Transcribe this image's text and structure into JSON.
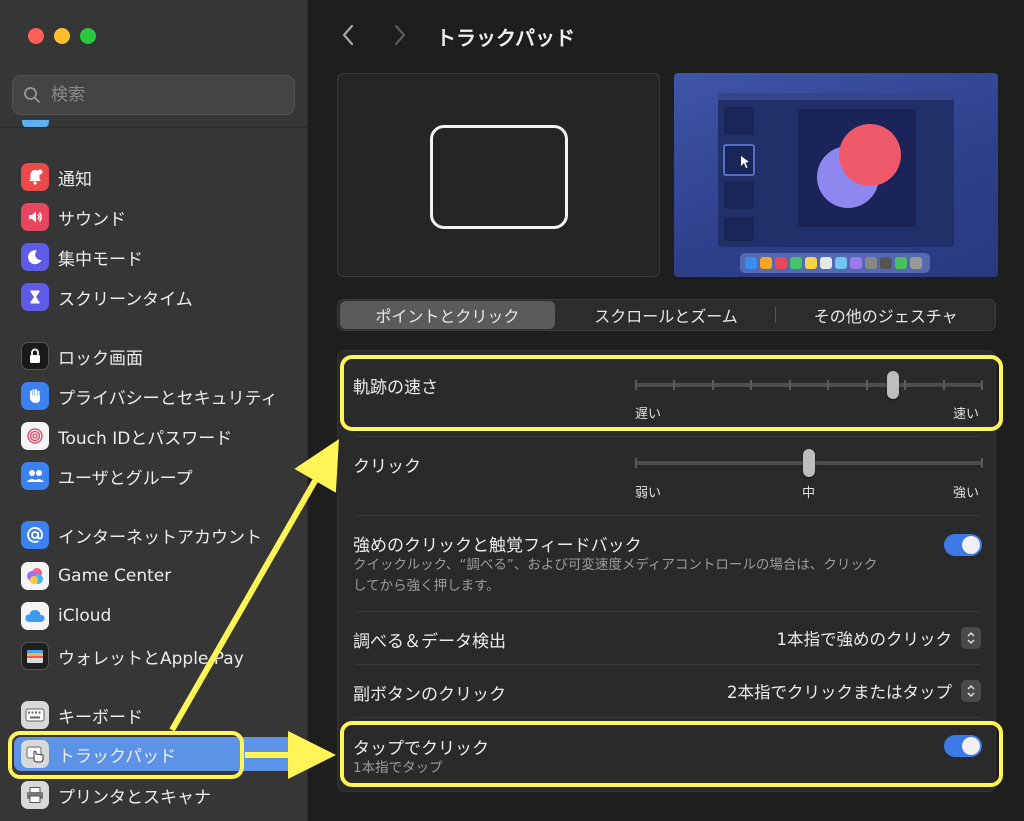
{
  "colors": {
    "accent": "#5c93e6",
    "toggle_on": "#3d7ae6",
    "highlight": "#fff556"
  },
  "sidebar": {
    "search_placeholder": "検索",
    "items": [
      {
        "label": "通知",
        "icon": "bell-icon"
      },
      {
        "label": "サウンド",
        "icon": "speaker-icon"
      },
      {
        "label": "集中モード",
        "icon": "moon-icon"
      },
      {
        "label": "スクリーンタイム",
        "icon": "hourglass-icon"
      },
      {
        "label": "ロック画面",
        "icon": "lock-icon"
      },
      {
        "label": "プライバシーとセキュリティ",
        "icon": "hand-icon"
      },
      {
        "label": "Touch IDとパスワード",
        "icon": "fingerprint-icon"
      },
      {
        "label": "ユーザとグループ",
        "icon": "users-icon"
      },
      {
        "label": "インターネットアカウント",
        "icon": "at-icon"
      },
      {
        "label": "Game Center",
        "icon": "game-center-icon"
      },
      {
        "label": "iCloud",
        "icon": "cloud-icon"
      },
      {
        "label": "ウォレットとApple Pay",
        "icon": "wallet-icon"
      },
      {
        "label": "キーボード",
        "icon": "keyboard-icon"
      },
      {
        "label": "トラックパッド",
        "icon": "trackpad-icon"
      },
      {
        "label": "プリンタとスキャナ",
        "icon": "printer-icon"
      }
    ]
  },
  "header": {
    "title": "トラックパッド"
  },
  "tabs": [
    "ポイントとクリック",
    "スクロールとズーム",
    "その他のジェスチャ"
  ],
  "settings": {
    "tracking_speed": {
      "label": "軌跡の速さ",
      "min_label": "遅い",
      "max_label": "速い",
      "value_fraction": 0.75
    },
    "click": {
      "label": "クリック",
      "min_label": "弱い",
      "mid_label": "中",
      "max_label": "強い",
      "value_fraction": 0.5
    },
    "force_click": {
      "label": "強めのクリックと触覚フィードバック",
      "description_line1": "クイックルック、“調べる”、および可変速度メディアコントロールの場合は、クリック",
      "description_line2": "してから強く押します。",
      "enabled": true
    },
    "lookup": {
      "label": "調べる＆データ検出",
      "value": "1本指で強めのクリック"
    },
    "secondary_click": {
      "label": "副ボタンのクリック",
      "value": "2本指でクリックまたはタップ"
    },
    "tap_to_click": {
      "label": "タップでクリック",
      "description": "1本指でタップ",
      "enabled": true
    }
  }
}
